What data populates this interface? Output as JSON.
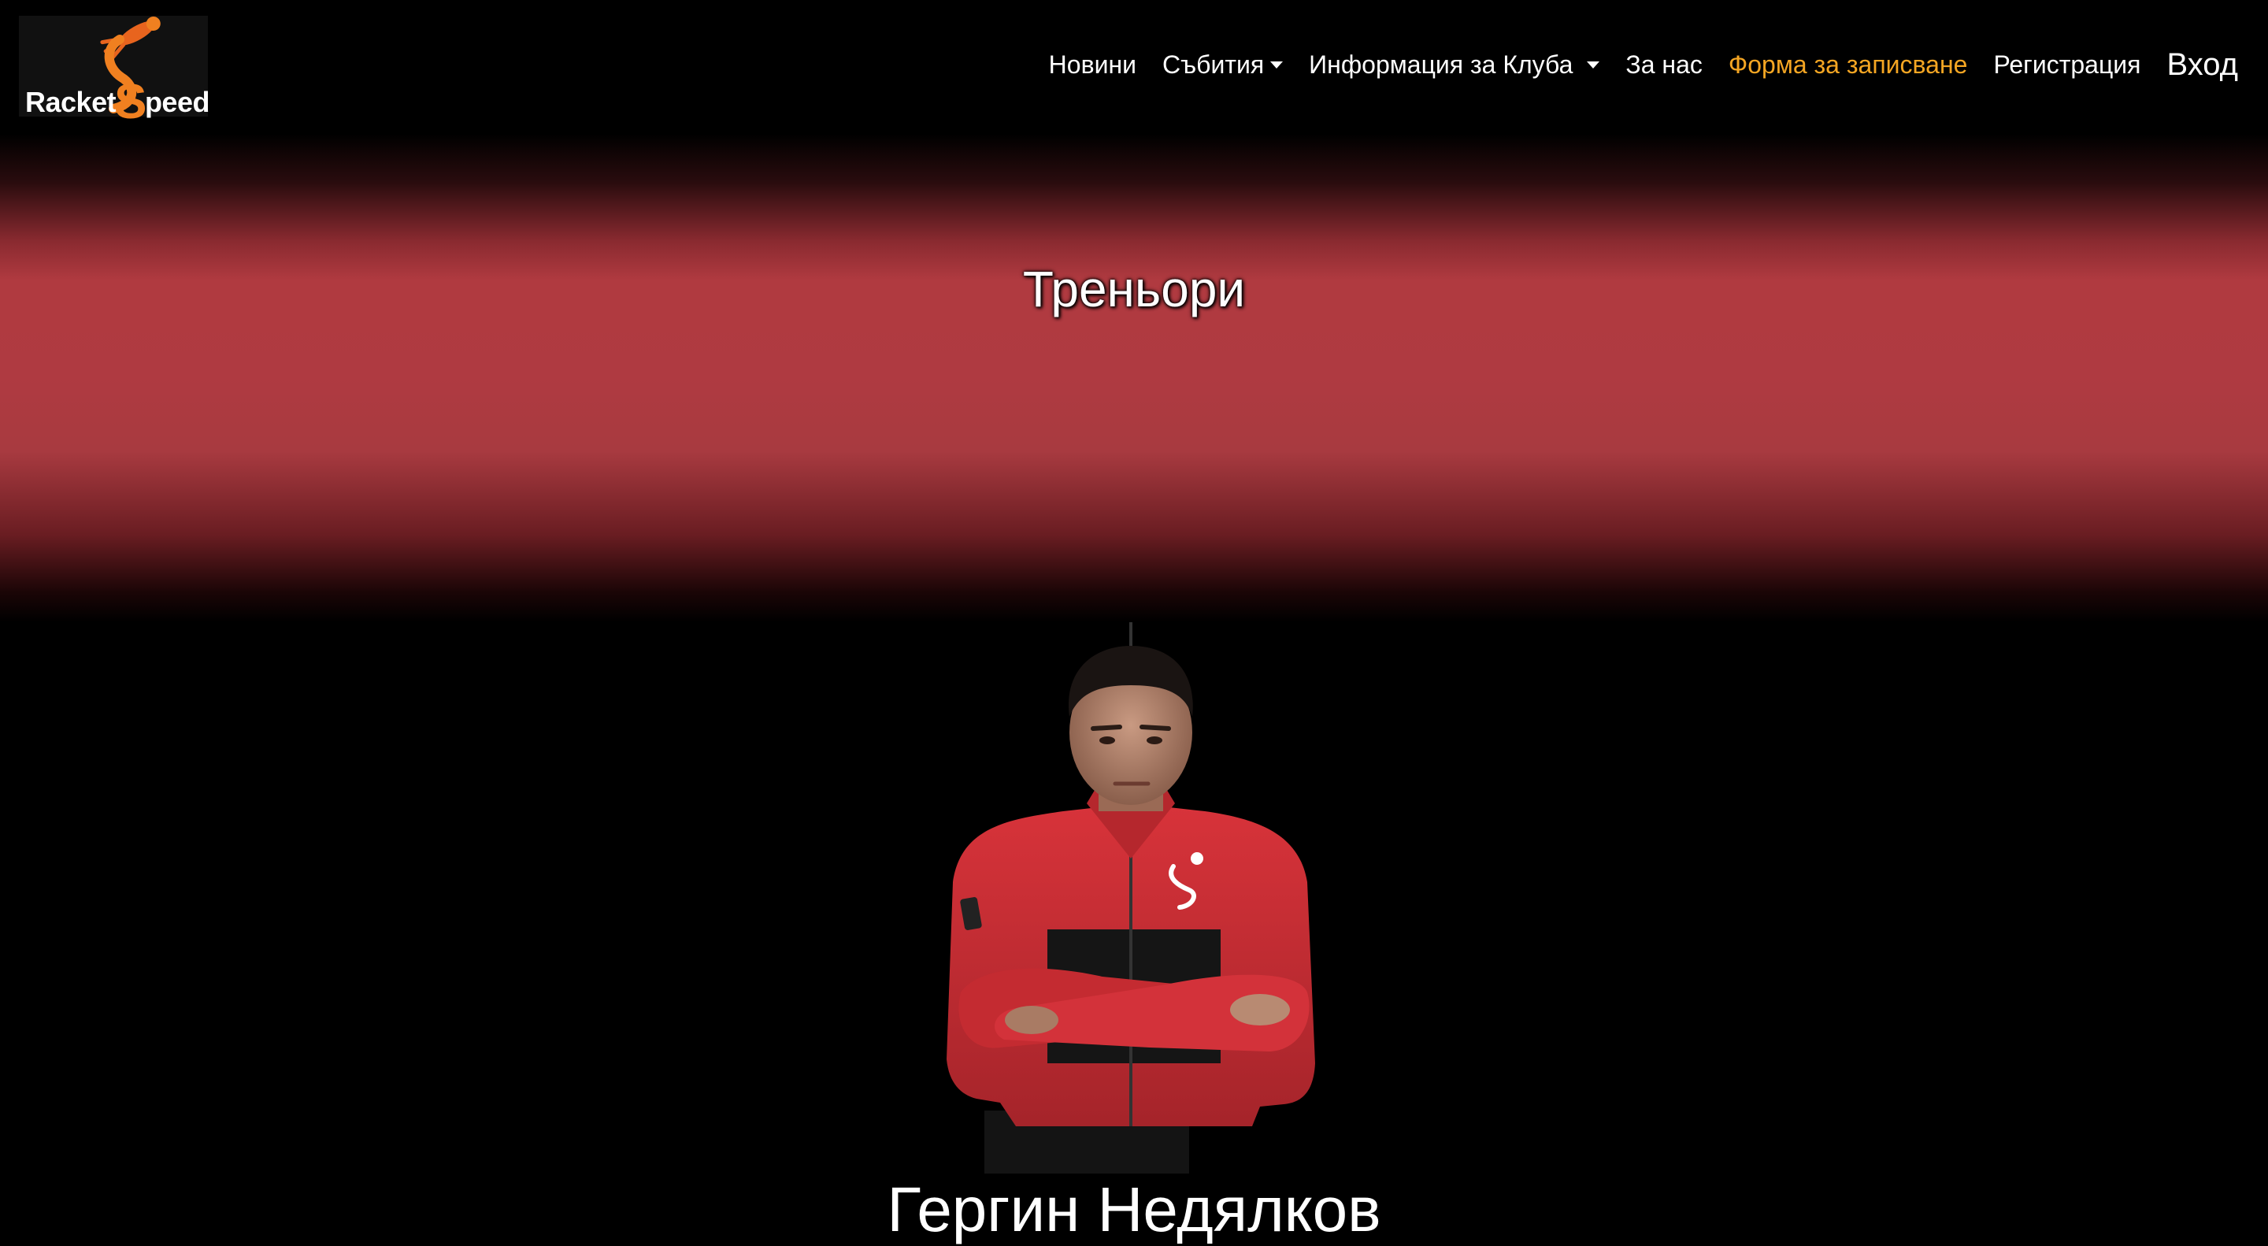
{
  "brand": {
    "logo_text_before": "Racket",
    "logo_text_s": "S",
    "logo_text_after": "peed"
  },
  "nav": {
    "news": "Новини",
    "events": "Събития",
    "club_info": "Информация за Клуба",
    "about": "За нас",
    "signup_form": "Форма за записване",
    "register": "Регистрация",
    "login": "Вход"
  },
  "hero": {
    "title": "Треньори"
  },
  "coach": {
    "name": "Гергин Недялков"
  },
  "colors": {
    "background": "#000000",
    "accent": "#f5a623",
    "hero_red": "#b03a40",
    "jacket_red": "#c8282e"
  }
}
